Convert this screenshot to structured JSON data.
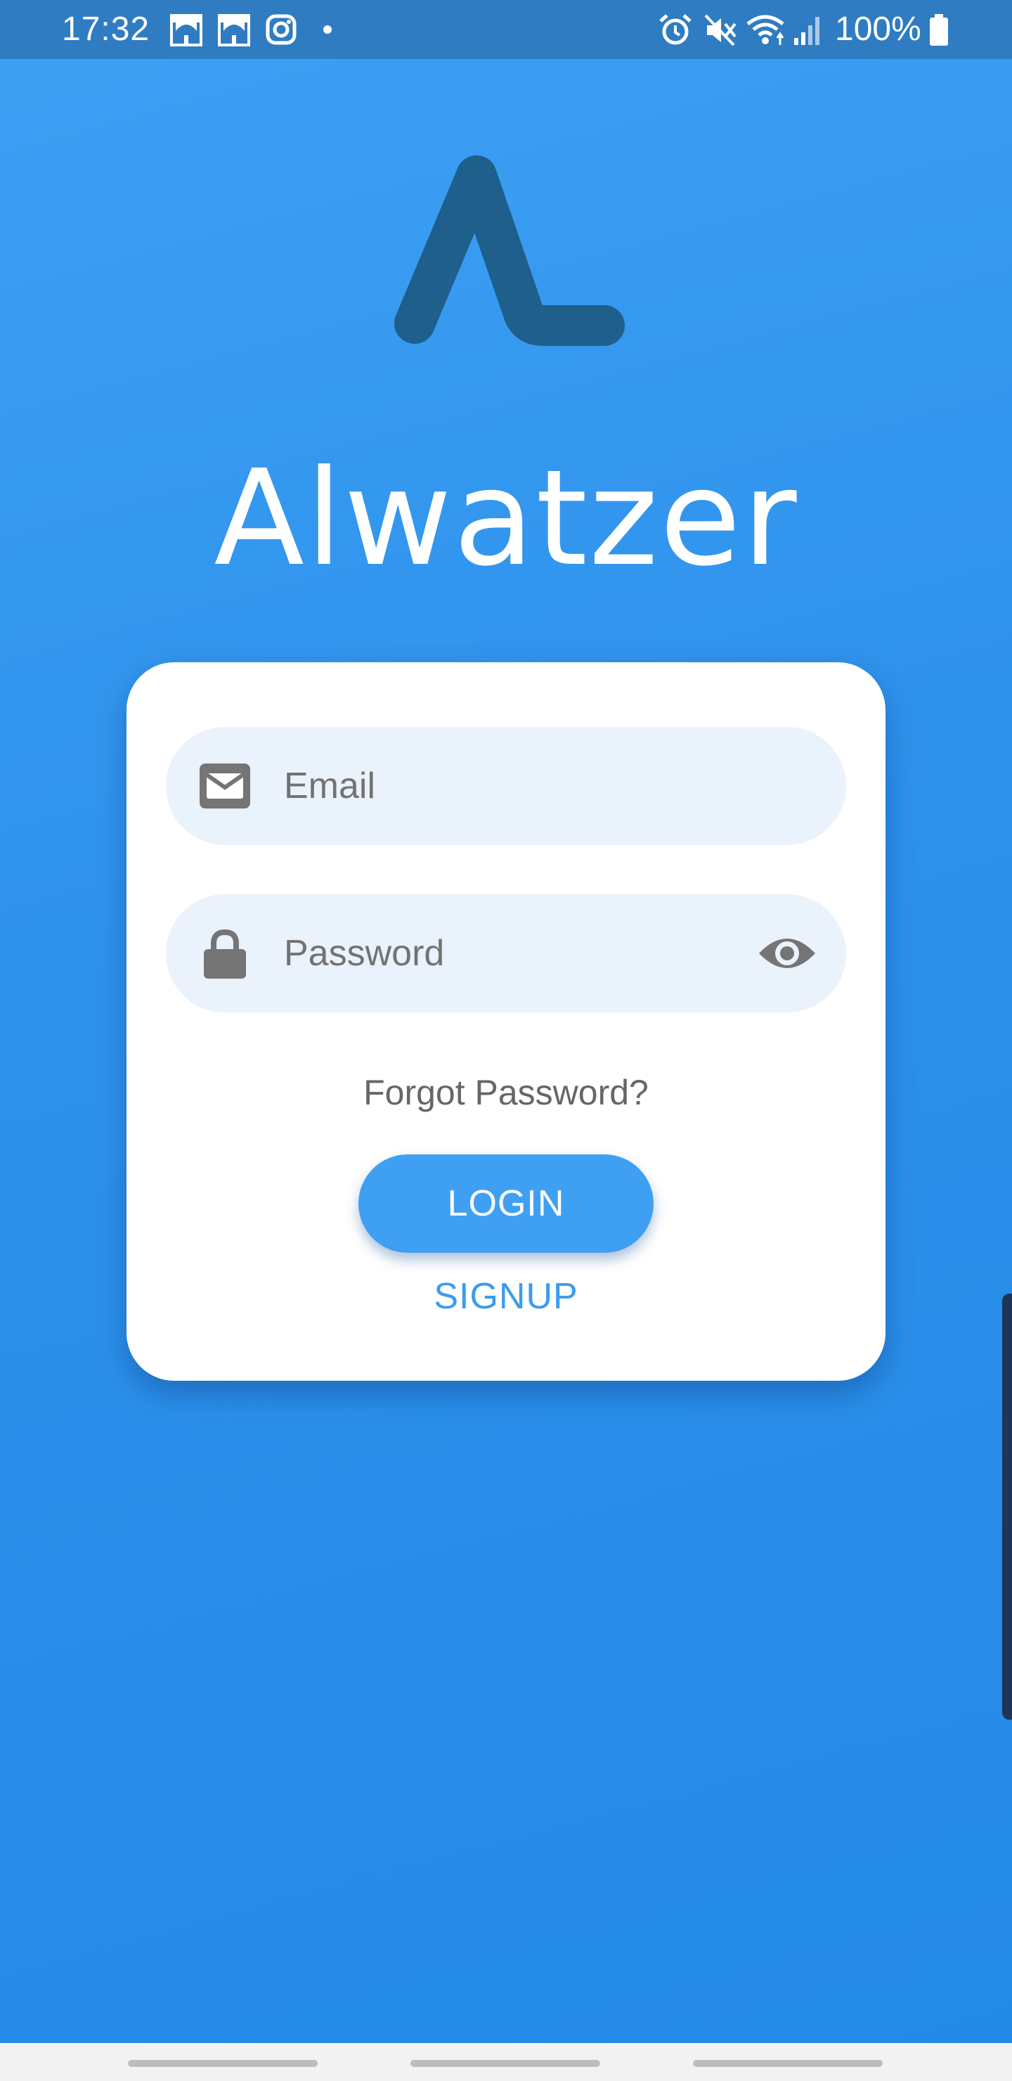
{
  "status_bar": {
    "time": "17:32",
    "battery": "100%",
    "left_icons": [
      "mosque-icon",
      "mosque-icon",
      "instagram-icon",
      "dot-icon"
    ],
    "right_icons": [
      "alarm-icon",
      "mute-icon",
      "wifi-icon",
      "signal-icon",
      "battery-icon"
    ]
  },
  "app": {
    "title": "Alwatzer",
    "logo_color": "#1e5f8c"
  },
  "login_form": {
    "email_placeholder": "Email",
    "password_placeholder": "Password",
    "forgot_label": "Forgot Password?",
    "login_label": "LOGIN",
    "signup_label": "SIGNUP"
  },
  "colors": {
    "background": "#2f92ec",
    "accent": "#3fa0f3",
    "field_bg": "#eaf2fb",
    "icon_gray": "#757575"
  }
}
